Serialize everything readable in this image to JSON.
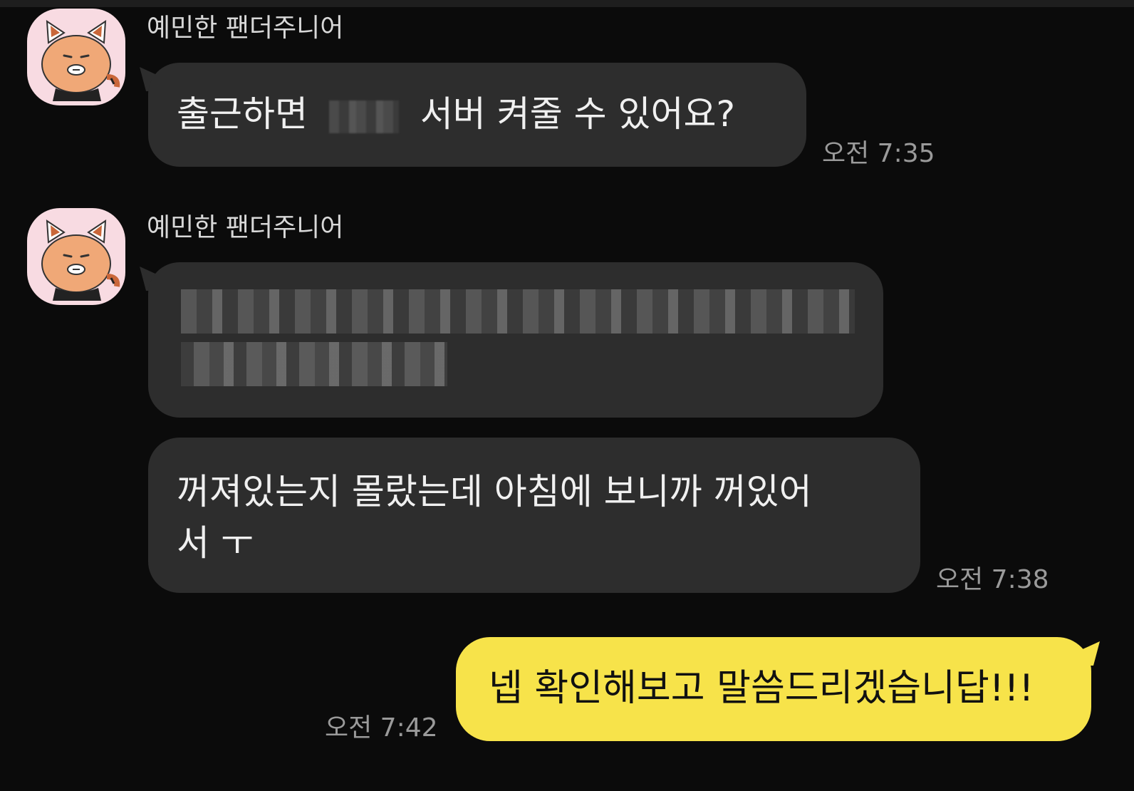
{
  "chat": {
    "messages": [
      {
        "sender": "예민한 팬더주니어",
        "text_before": "출근하면",
        "text_after": "서버 켜줄 수 있어요?",
        "time": "오전 7:35"
      },
      {
        "sender": "예민한 팬더주니어",
        "text": "[blurred]"
      },
      {
        "text_line1": "꺼져있는지 몰랐는데 아침에 보니까 꺼있어",
        "text_line2": "서 ㅜ",
        "time": "오전 7:38"
      },
      {
        "text": "넵 확인해보고 말씀드리겠습니답!!!",
        "time": "오전 7:42"
      }
    ]
  },
  "colors": {
    "background": "#0b0b0b",
    "incoming_bubble": "#2d2d2d",
    "outgoing_bubble": "#f7e34a",
    "avatar_bg": "#f8dbe2"
  }
}
